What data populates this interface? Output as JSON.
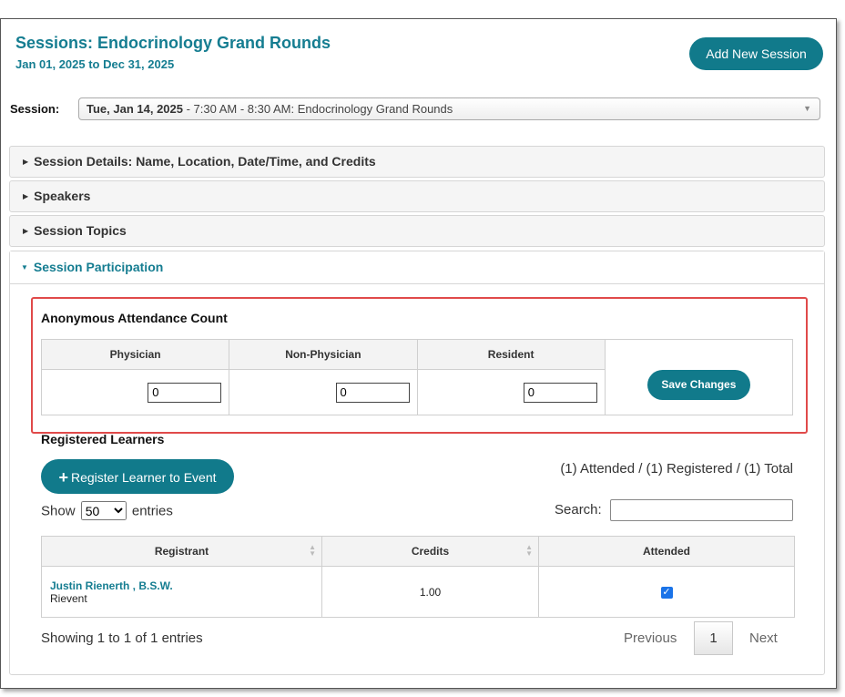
{
  "header": {
    "title": "Sessions: Endocrinology Grand Rounds",
    "date_range": "Jan 01, 2025 to Dec 31, 2025",
    "add_button": "Add New Session"
  },
  "session_selector": {
    "label": "Session:",
    "selected_date": "Tue, Jan 14, 2025",
    "selected_rest": " - 7:30 AM - 8:30 AM: Endocrinology Grand Rounds",
    "caret": "▼"
  },
  "panels": {
    "details": "Session Details: Name, Location, Date/Time, and Credits",
    "speakers": "Speakers",
    "topics": "Session Topics",
    "participation": "Session Participation"
  },
  "anonymous_attendance": {
    "title": "Anonymous Attendance Count",
    "columns": [
      "Physician",
      "Non-Physician",
      "Resident"
    ],
    "values": [
      "0",
      "0",
      "0"
    ],
    "save_button": "Save Changes"
  },
  "learners": {
    "title": "Registered Learners",
    "register_button": "Register Learner to Event",
    "summary": "(1) Attended / (1) Registered / (1) Total",
    "show_label": "Show",
    "entries_label": "entries",
    "page_size": "50",
    "search_label": "Search:",
    "columns": [
      "Registrant",
      "Credits",
      "Attended"
    ],
    "rows": [
      {
        "name": "Justin Rienerth , B.S.W.",
        "sub": "Rievent",
        "credits": "1.00",
        "attended": true
      }
    ],
    "showing": "Showing 1 to 1 of 1 entries",
    "pager": {
      "previous": "Previous",
      "page": "1",
      "next": "Next"
    }
  },
  "colors": {
    "accent": "#117a8b",
    "title": "#157d91",
    "highlight": "#e04a4a",
    "checkbox": "#1a73e8"
  },
  "icons": {
    "plus": "plus-icon",
    "caret": "chevron-down-icon",
    "collapsed": "caret-right-icon",
    "expanded": "caret-down-icon",
    "sort": "sort-icon",
    "check": "checkmark-icon"
  }
}
